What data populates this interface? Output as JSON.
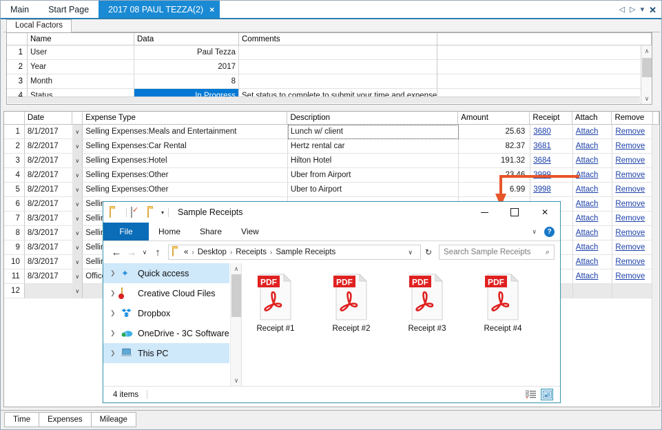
{
  "window": {
    "tabs": [
      {
        "label": "Main",
        "active": false
      },
      {
        "label": "Start Page",
        "active": false
      },
      {
        "label": "2017 08 PAUL TEZZA(2)",
        "active": true,
        "close": "×"
      }
    ],
    "nav": {
      "prev": "◁",
      "next": "▷",
      "menu": "▾",
      "close": "✕"
    }
  },
  "local_factors": {
    "tab_label": "Local Factors",
    "columns": [
      "",
      "Name",
      "Data",
      "Comments"
    ],
    "rows": [
      {
        "num": "1",
        "name": "User",
        "data": "Paul Tezza",
        "comments": "",
        "highlight": false
      },
      {
        "num": "2",
        "name": "Year",
        "data": "2017",
        "comments": "",
        "highlight": false
      },
      {
        "num": "3",
        "name": "Month",
        "data": "8",
        "comments": "",
        "highlight": false
      },
      {
        "num": "4",
        "name": "Status",
        "data": "In Progress",
        "comments": "Set status to complete to submit your time and expenses.",
        "highlight": true
      }
    ],
    "scrollbar": {
      "up": "∧",
      "down": "∨"
    }
  },
  "expenses": {
    "columns": [
      "",
      "Date",
      "",
      "Expense Type",
      "Description",
      "Amount",
      "Receipt",
      "Attach",
      "Remove"
    ],
    "dropdown_glyph": "∨",
    "rows": [
      {
        "num": "1",
        "date": "8/1/2017",
        "type": "Selling Expenses:Meals and Entertainment",
        "desc": "Lunch w/ client",
        "amount": "25.63",
        "receipt": "3680",
        "attach": "Attach",
        "remove": "Remove",
        "focus": true
      },
      {
        "num": "2",
        "date": "8/2/2017",
        "type": "Selling Expenses:Car Rental",
        "desc": "Hertz rental car",
        "amount": "82.37",
        "receipt": "3681",
        "attach": "Attach",
        "remove": "Remove"
      },
      {
        "num": "3",
        "date": "8/2/2017",
        "type": "Selling Expenses:Hotel",
        "desc": "Hilton Hotel",
        "amount": "191.32",
        "receipt": "3684",
        "attach": "Attach",
        "remove": "Remove"
      },
      {
        "num": "4",
        "date": "8/2/2017",
        "type": "Selling Expenses:Other",
        "desc": "Uber from Airport",
        "amount": "23.46",
        "receipt": "3999",
        "attach": "Attach",
        "remove": "Remove"
      },
      {
        "num": "5",
        "date": "8/2/2017",
        "type": "Selling Expenses:Other",
        "desc": "Uber to Airport",
        "amount": "6.99",
        "receipt": "3998",
        "attach": "Attach",
        "remove": "Remove"
      },
      {
        "num": "6",
        "date": "8/2/2017",
        "type": "Selling",
        "desc": "",
        "amount": "",
        "receipt": "",
        "attach": "Attach",
        "remove": "Remove"
      },
      {
        "num": "7",
        "date": "8/3/2017",
        "type": "Selling",
        "desc": "",
        "amount": "",
        "receipt": "",
        "attach": "Attach",
        "remove": "Remove"
      },
      {
        "num": "8",
        "date": "8/3/2017",
        "type": "Selling",
        "desc": "",
        "amount": "",
        "receipt": "",
        "attach": "Attach",
        "remove": "Remove"
      },
      {
        "num": "9",
        "date": "8/3/2017",
        "type": "Selling",
        "desc": "",
        "amount": "",
        "receipt": "",
        "attach": "Attach",
        "remove": "Remove"
      },
      {
        "num": "10",
        "date": "8/3/2017",
        "type": "Selling",
        "desc": "",
        "amount": "",
        "receipt": "",
        "attach": "Attach",
        "remove": "Remove"
      },
      {
        "num": "11",
        "date": "8/3/2017",
        "type": "Office",
        "desc": "",
        "amount": "",
        "receipt": "",
        "attach": "Attach",
        "remove": "Remove"
      },
      {
        "num": "12",
        "date": "",
        "type": "",
        "desc": "",
        "amount": "",
        "receipt": "",
        "attach": "",
        "remove": "",
        "empty": true
      }
    ]
  },
  "bottom_tabs": [
    {
      "label": "Time",
      "active": false
    },
    {
      "label": "Expenses",
      "active": true
    },
    {
      "label": "Mileage",
      "active": false
    }
  ],
  "file_explorer": {
    "title": "Sample Receipts",
    "quick_access": [
      "folder-icon",
      "properties-icon",
      "new-folder-icon",
      "customize-caret"
    ],
    "window_controls": {
      "minimize": "–",
      "maximize": "☐",
      "close": "✕"
    },
    "ribbon_tabs": [
      "File",
      "Home",
      "Share",
      "View"
    ],
    "ribbon_right": {
      "collapse": "∨",
      "help": "?"
    },
    "address": {
      "back": "←",
      "forward": "→",
      "recent": "∨",
      "up": "↑",
      "crumbs": [
        "«",
        "Desktop",
        "Receipts",
        "Sample Receipts"
      ],
      "separator": "›",
      "dropdown": "∨",
      "refresh": "↻"
    },
    "search": {
      "placeholder": "Search Sample Receipts",
      "icon": "⌕"
    },
    "nav_pane": [
      {
        "label": "Quick access",
        "icon": "star-icon",
        "selected": true
      },
      {
        "label": "Creative Cloud Files",
        "icon": "creative-cloud-icon",
        "selected": false
      },
      {
        "label": "Dropbox",
        "icon": "dropbox-icon",
        "selected": false
      },
      {
        "label": "OneDrive - 3C Software",
        "icon": "onedrive-icon",
        "selected": false
      },
      {
        "label": "This PC",
        "icon": "this-pc-icon",
        "selected": true
      }
    ],
    "nav_scroll": {
      "up": "∧",
      "down": "∨"
    },
    "files": [
      {
        "label": "Receipt #1",
        "type": "PDF"
      },
      {
        "label": "Receipt #2",
        "type": "PDF"
      },
      {
        "label": "Receipt #3",
        "type": "PDF"
      },
      {
        "label": "Receipt #4",
        "type": "PDF"
      }
    ],
    "status": "4 items",
    "view_buttons": [
      {
        "name": "details-view",
        "active": false
      },
      {
        "name": "large-icons-view",
        "active": true
      }
    ]
  },
  "annotation": {
    "arrow_color": "#e8552a"
  },
  "colors": {
    "accent_blue": "#1a8ad4",
    "selection_blue": "#0078d4",
    "link_blue": "#1a3fa8",
    "pdf_red": "#e02020",
    "file_tab_blue": "#0b6cb7"
  }
}
